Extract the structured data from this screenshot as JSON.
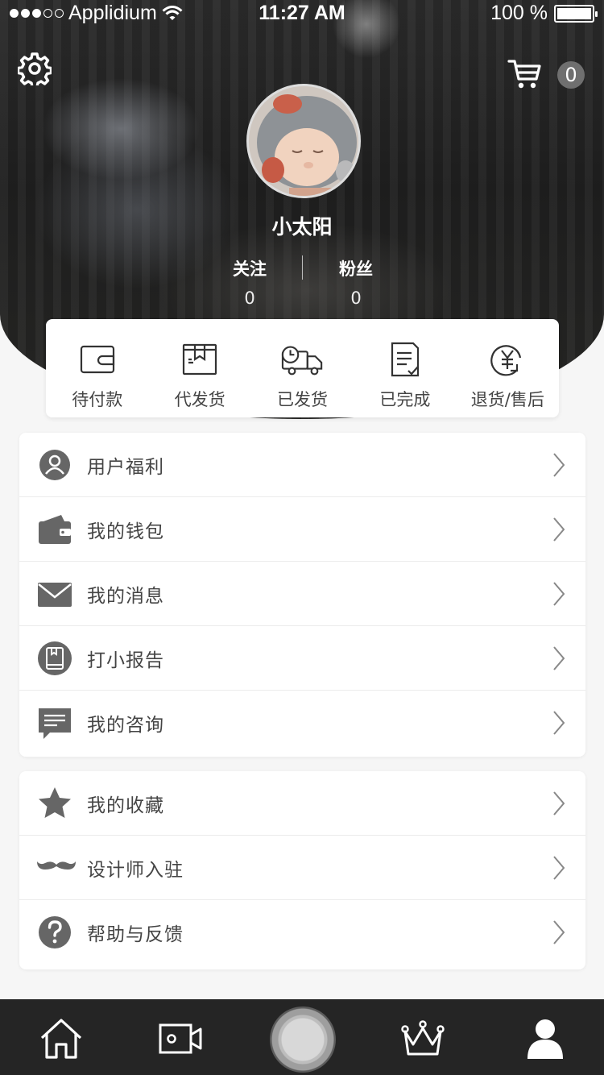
{
  "status_bar": {
    "carrier": "Applidium",
    "time": "11:27 AM",
    "battery": "100 %",
    "signal_bars": 3,
    "signal_total": 5
  },
  "header": {
    "settings_icon": "gear-icon",
    "cart_icon": "cart-icon",
    "cart_count": "0",
    "username": "小太阳",
    "follow_label": "关注",
    "follow_count": "0",
    "fans_label": "粉丝",
    "fans_count": "0"
  },
  "orders": [
    {
      "label": "待付款",
      "icon": "wallet-icon"
    },
    {
      "label": "代发货",
      "icon": "package-icon"
    },
    {
      "label": "已发货",
      "icon": "truck-icon"
    },
    {
      "label": "已完成",
      "icon": "checklist-icon"
    },
    {
      "label": "退货/售后",
      "icon": "refund-icon"
    }
  ],
  "menu_group_1": [
    {
      "label": "用户福利",
      "icon": "user-icon"
    },
    {
      "label": "我的钱包",
      "icon": "wallet-icon"
    },
    {
      "label": "我的消息",
      "icon": "envelope-icon"
    },
    {
      "label": "打小报告",
      "icon": "book-icon"
    },
    {
      "label": "我的咨询",
      "icon": "chat-icon"
    }
  ],
  "menu_group_2": [
    {
      "label": "我的收藏",
      "icon": "star-icon"
    },
    {
      "label": "设计师入驻",
      "icon": "mustache-icon"
    },
    {
      "label": "帮助与反馈",
      "icon": "help-icon"
    }
  ],
  "tab_bar": [
    {
      "name": "home",
      "icon": "home-icon"
    },
    {
      "name": "video",
      "icon": "video-icon"
    },
    {
      "name": "center",
      "icon": "record-icon"
    },
    {
      "name": "crown",
      "icon": "crown-icon"
    },
    {
      "name": "profile",
      "icon": "profile-icon"
    }
  ],
  "colors": {
    "header_dark": "#1e1e1e",
    "icon_gray": "#6a6a6a",
    "tabbar_bg": "#252525"
  }
}
